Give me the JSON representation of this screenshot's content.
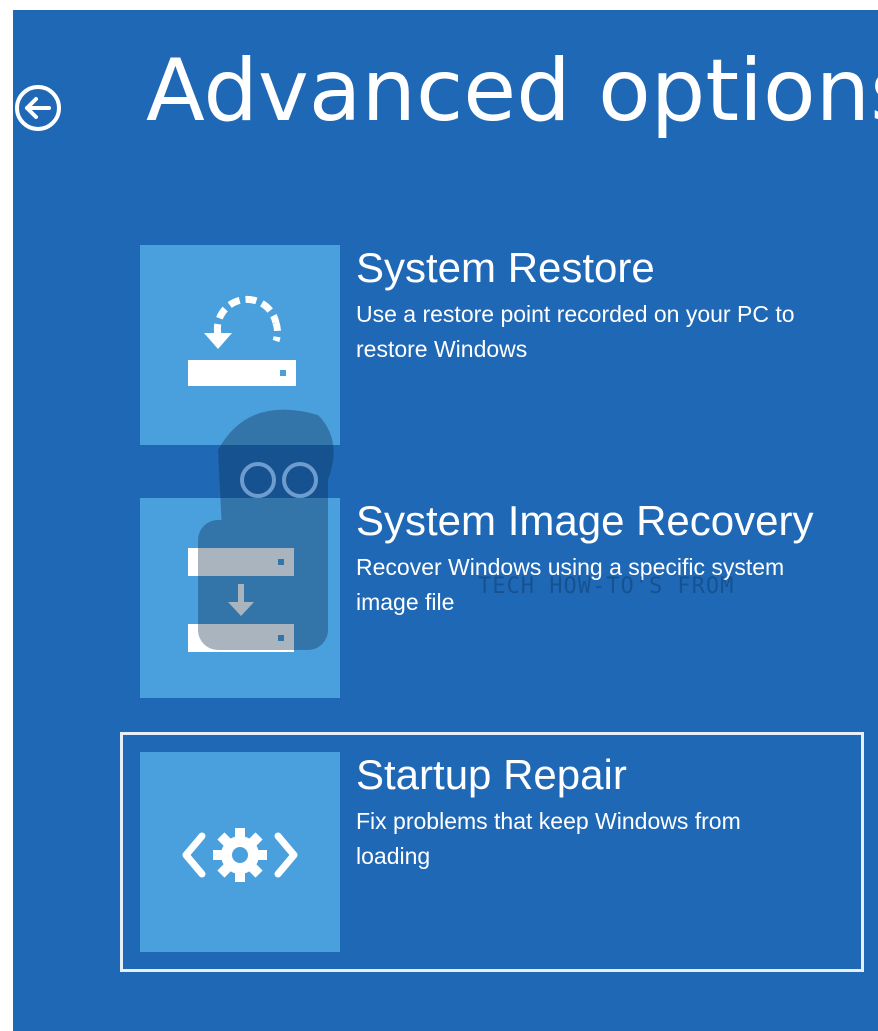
{
  "header": {
    "title": "Advanced options",
    "back_icon": "arrow-left-circle-icon"
  },
  "options": [
    {
      "title": "System Restore",
      "description": "Use a restore point recorded on your PC to restore Windows",
      "icon": "restore-drive-icon"
    },
    {
      "title": "System Image Recovery",
      "description": "Recover Windows using a specific system image file",
      "icon": "image-recovery-drive-icon"
    },
    {
      "title": "Startup Repair",
      "description": "Fix problems that keep Windows from loading",
      "icon": "startup-repair-gear-icon",
      "selected": true
    }
  ],
  "watermark": {
    "tagline": "TECH HOW-TO'S FROM"
  },
  "colors": {
    "background": "#1f68b6",
    "tile": "#4a9fdd",
    "text": "#ffffff",
    "selection_outline": "#e6eff9"
  }
}
